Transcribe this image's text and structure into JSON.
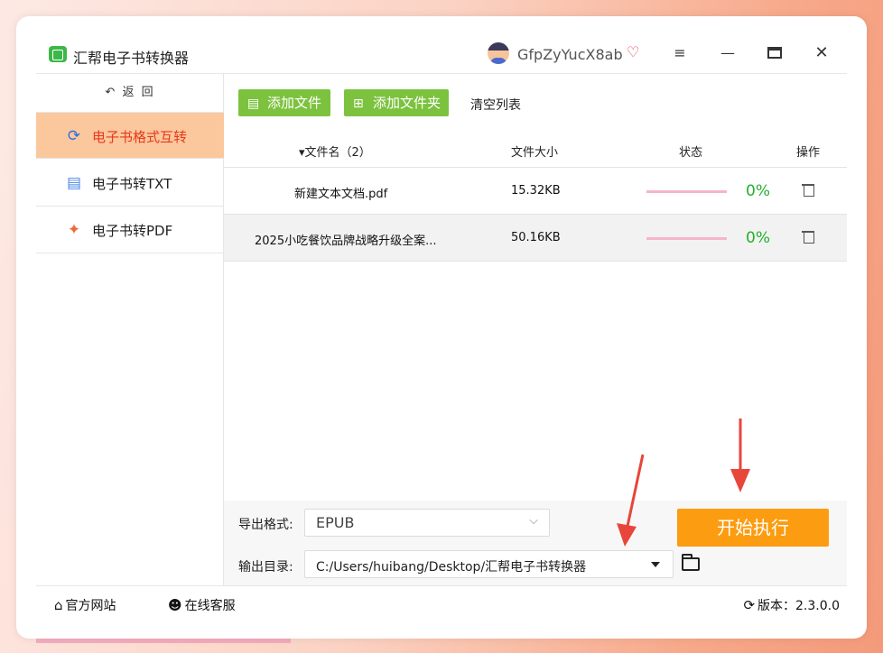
{
  "app": {
    "title": "汇帮电子书转换器",
    "user": "GfpZyYucX8ab"
  },
  "sidebar": {
    "back_label": "返  回",
    "items": [
      {
        "label": "电子书格式互转",
        "icon": "refresh-icon",
        "active": true
      },
      {
        "label": "电子书转TXT",
        "icon": "document-icon",
        "active": false
      },
      {
        "label": "电子书转PDF",
        "icon": "pdf-icon",
        "active": false
      }
    ]
  },
  "toolbar": {
    "add_file": "添加文件",
    "add_folder": "添加文件夹",
    "clear": "清空列表"
  },
  "table": {
    "headers": {
      "name": "文件名（2）",
      "size": "文件大小",
      "status": "状态",
      "action": "操作"
    },
    "rows": [
      {
        "name": "新建文本文档.pdf",
        "size": "15.32KB",
        "progress": "0%"
      },
      {
        "name": "2025小吃餐饮品牌战略升级全案...",
        "size": "50.16KB",
        "progress": "0%"
      }
    ]
  },
  "output": {
    "format_label": "导出格式:",
    "format_value": "EPUB",
    "dir_label": "输出目录:",
    "dir_value": "C:/Users/huibang/Desktop/汇帮电子书转换器"
  },
  "start_label": "开始执行",
  "footer": {
    "website": "官方网站",
    "service": "在线客服",
    "version": "版本：2.3.0.0"
  },
  "colors": {
    "accent_orange": "#fc9c10",
    "green": "#7cc23e",
    "active_bg": "#fbc79c",
    "active_text": "#e8381c",
    "progress_text": "#22b02a"
  }
}
